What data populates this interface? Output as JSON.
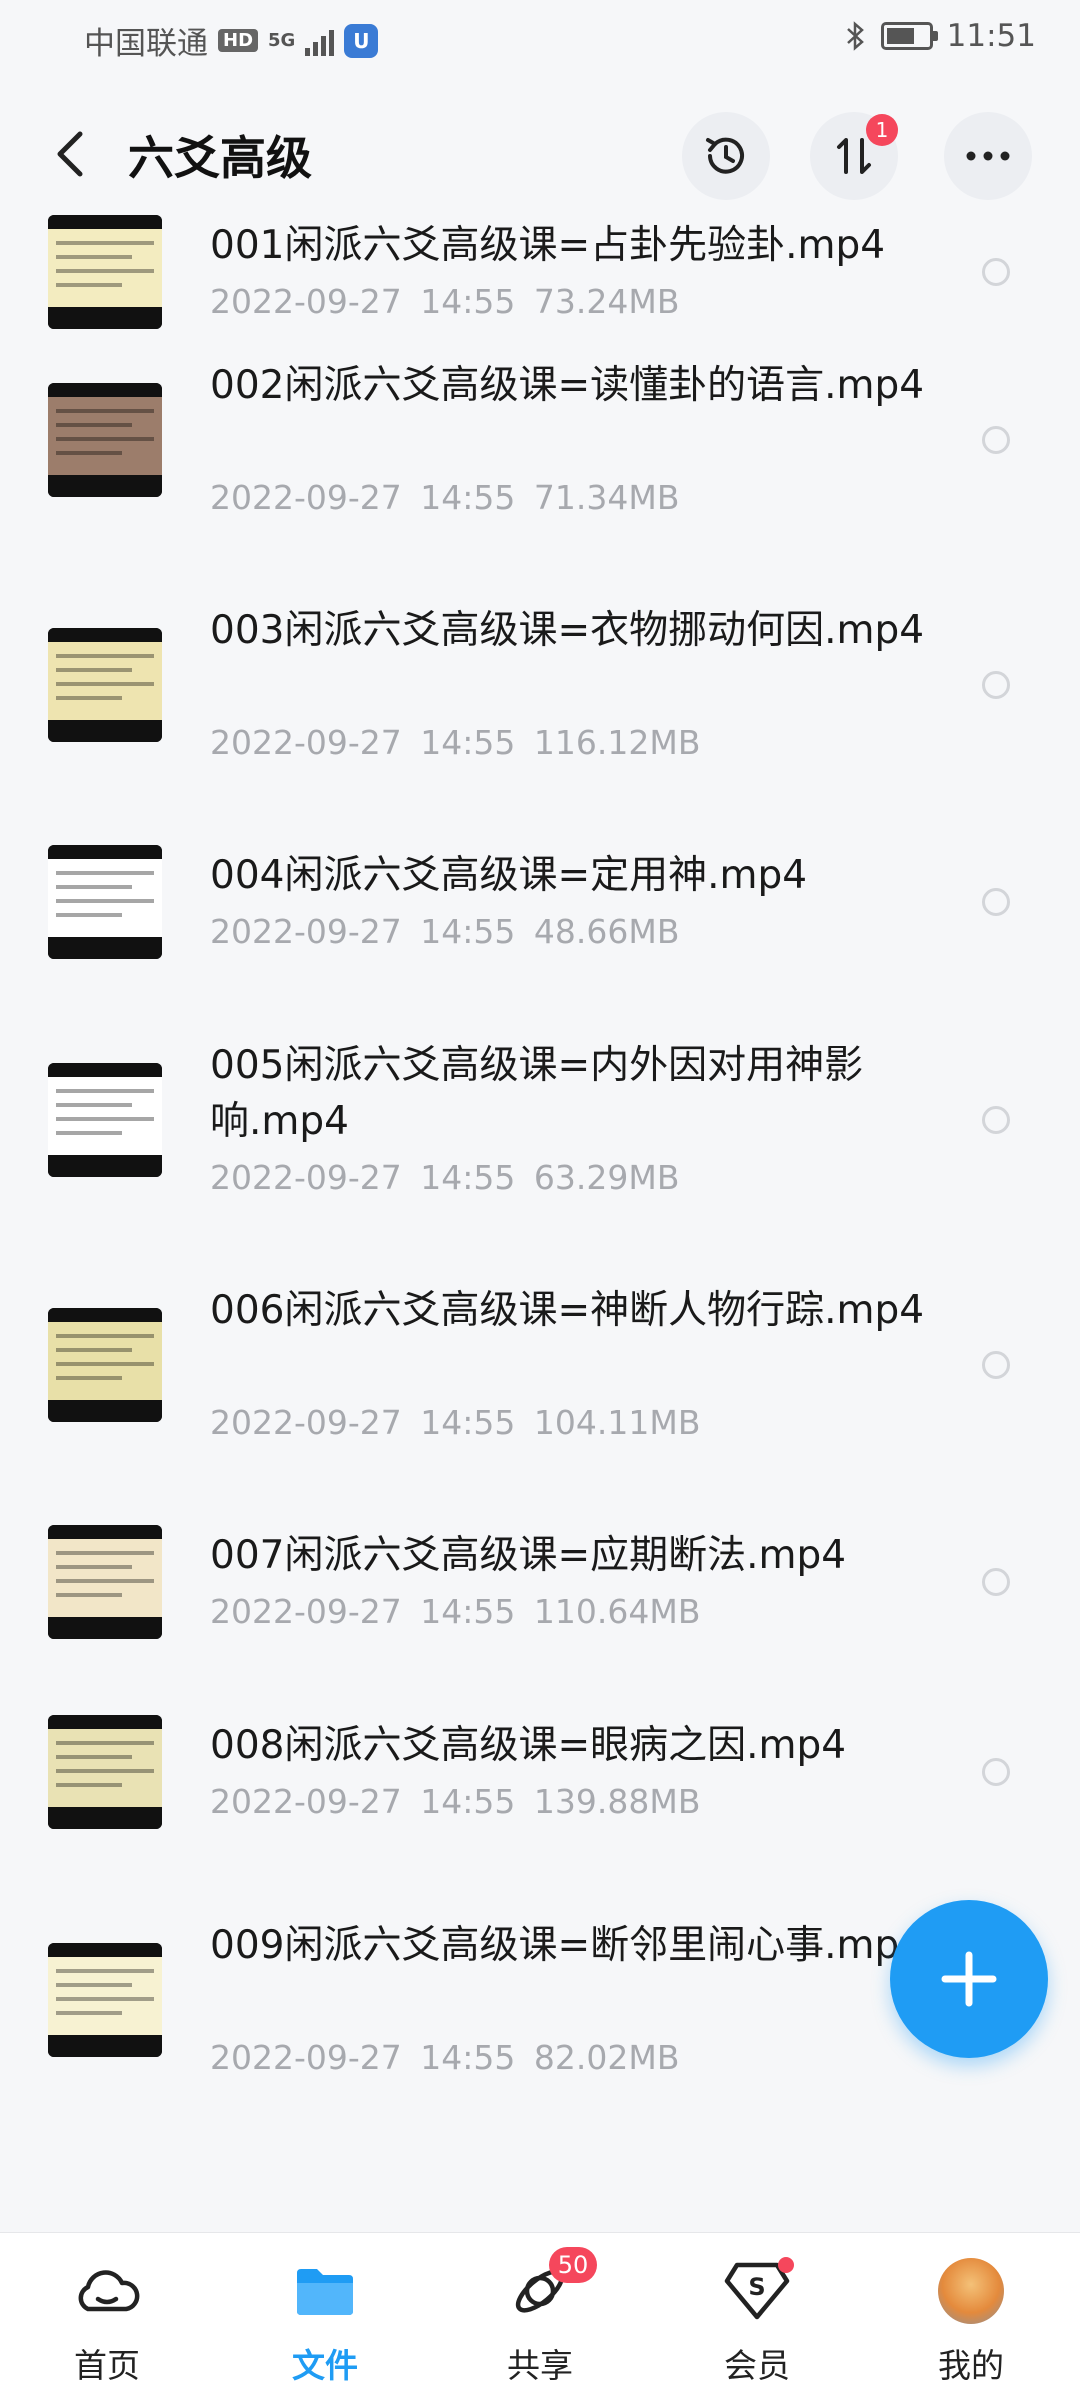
{
  "status_bar": {
    "carrier": "中国联通",
    "network_badge": "HD",
    "network_type": "5G",
    "time": "11:51"
  },
  "header": {
    "title": "六爻高级",
    "transfer_badge": "1",
    "icons": {
      "back": "chevron-left-icon",
      "history": "history-icon",
      "transfer": "transfer-icon",
      "more": "more-icon"
    }
  },
  "files": [
    {
      "name": "001闲派六爻高级课=占卦先验卦.mp4",
      "date": "2022-09-27",
      "time": "14:55",
      "size": "73.24MB",
      "thumb_color": "#f3ecc0"
    },
    {
      "name": "002闲派六爻高级课=读懂卦的语言.mp4",
      "date": "2022-09-27",
      "time": "14:55",
      "size": "71.34MB",
      "thumb_color": "#9c7d6b"
    },
    {
      "name": "003闲派六爻高级课=衣物挪动何因.mp4",
      "date": "2022-09-27",
      "time": "14:55",
      "size": "116.12MB",
      "thumb_color": "#eee4b0"
    },
    {
      "name": "004闲派六爻高级课=定用神.mp4",
      "date": "2022-09-27",
      "time": "14:55",
      "size": "48.66MB",
      "thumb_color": "#ffffff"
    },
    {
      "name": "005闲派六爻高级课=内外因对用神影响.mp4",
      "date": "2022-09-27",
      "time": "14:55",
      "size": "63.29MB",
      "thumb_color": "#ffffff"
    },
    {
      "name": "006闲派六爻高级课=神断人物行踪.mp4",
      "date": "2022-09-27",
      "time": "14:55",
      "size": "104.11MB",
      "thumb_color": "#e8e0a8"
    },
    {
      "name": "007闲派六爻高级课=应期断法.mp4",
      "date": "2022-09-27",
      "time": "14:55",
      "size": "110.64MB",
      "thumb_color": "#f2e6c8"
    },
    {
      "name": "008闲派六爻高级课=眼病之因.mp4",
      "date": "2022-09-27",
      "time": "14:55",
      "size": "139.88MB",
      "thumb_color": "#e9e2b4"
    },
    {
      "name": "009闲派六爻高级课=断邻里闹心事.mp4",
      "date": "2022-09-27",
      "time": "14:55",
      "size": "82.02MB",
      "thumb_color": "#f7f2d2"
    }
  ],
  "fab": {
    "icon": "plus-icon"
  },
  "bottom_nav": [
    {
      "label": "首页",
      "icon": "home-cloud-icon"
    },
    {
      "label": "文件",
      "icon": "folder-icon",
      "active": true
    },
    {
      "label": "共享",
      "icon": "share-orbit-icon",
      "badge": "50"
    },
    {
      "label": "会员",
      "icon": "vip-s-icon",
      "dot": true
    },
    {
      "label": "我的",
      "icon": "avatar-icon"
    }
  ],
  "colors": {
    "accent": "#1f9cf4",
    "badge": "#f5475c",
    "meta_text": "#a7a9ae"
  }
}
